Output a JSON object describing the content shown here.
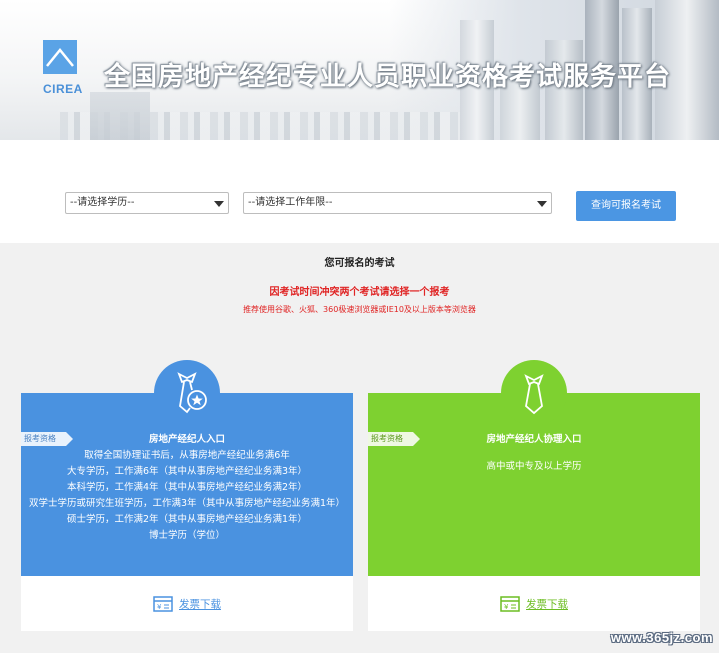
{
  "header": {
    "logo_text": "CIREA",
    "title": "全国房地产经纪专业人员职业资格考试服务平台"
  },
  "filter": {
    "education_select": "--请选择学历--",
    "work_years_select": "--请选择工作年限--",
    "query_button": "查询可报名考试"
  },
  "section": {
    "title": "您可报名的考试",
    "warning": "因考试时间冲突两个考试请选择一个报考",
    "browser_notice": "推荐使用谷歌、火狐、360极速浏览器或IE10及以上版本等浏览器"
  },
  "cards": [
    {
      "tag": "报考资格",
      "title": "房地产经纪人入口",
      "requirements": [
        "取得全国协理证书后，从事房地产经纪业务满6年",
        "大专学历，工作满6年（其中从事房地产经纪业务满3年）",
        "本科学历，工作满4年（其中从事房地产经纪业务满2年）",
        "双学士学历或研究生班学历，工作满3年（其中从事房地产经纪业务满1年）",
        "硕士学历，工作满2年（其中从事房地产经纪业务满1年）",
        "博士学历（学位）"
      ],
      "download": "发票下载",
      "accent": "#4a92e0"
    },
    {
      "tag": "报考资格",
      "title": "房地产经纪人协理入口",
      "requirements": [
        "高中或中专及以上学历"
      ],
      "download": "发票下载",
      "accent": "#7ed130"
    }
  ],
  "watermark": "www.365jz.com"
}
